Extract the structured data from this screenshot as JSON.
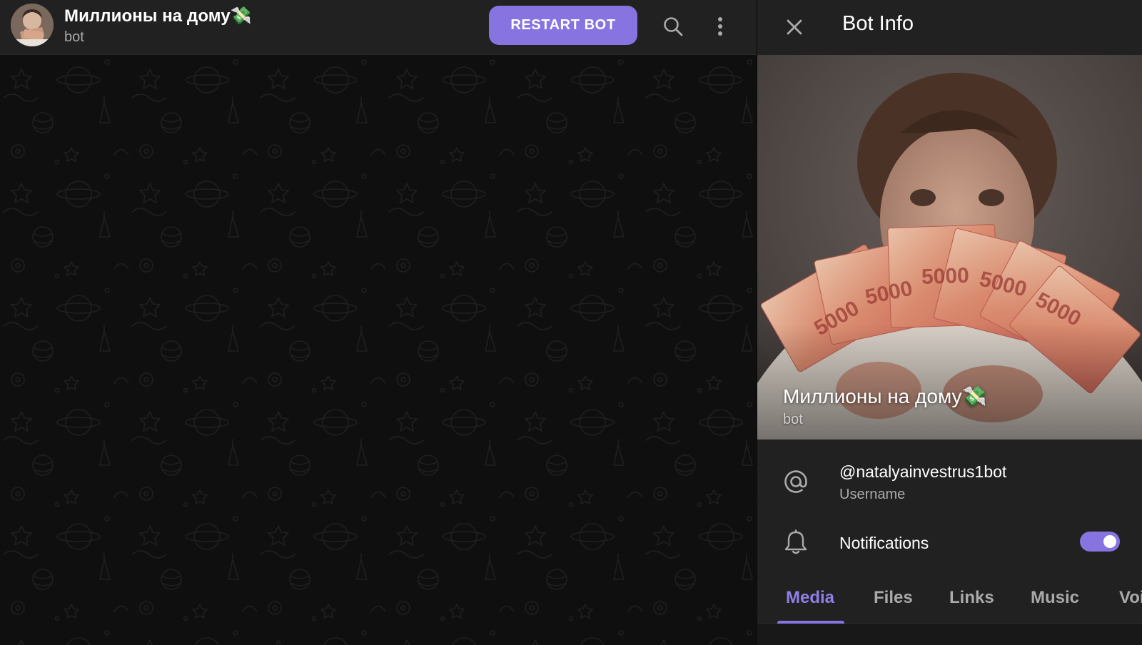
{
  "chat": {
    "title": "Миллионы на дому💸",
    "subtitle": "bot",
    "restart_label": "RESTART BOT",
    "icons": {
      "search": "search-icon",
      "menu": "more-vertical-icon"
    }
  },
  "info_panel": {
    "title": "Bot Info",
    "close_icon": "close-icon",
    "profile": {
      "name": "Миллионы на дому💸",
      "subtitle": "bot"
    },
    "username": {
      "value": "@natalyainvestrus1bot",
      "label": "Username",
      "icon": "at-icon"
    },
    "notifications": {
      "label": "Notifications",
      "enabled": true,
      "icon": "bell-icon"
    },
    "tabs": [
      {
        "label": "Media",
        "active": true
      },
      {
        "label": "Files",
        "active": false
      },
      {
        "label": "Links",
        "active": false
      },
      {
        "label": "Music",
        "active": false
      },
      {
        "label": "Voi",
        "active": false
      }
    ]
  },
  "colors": {
    "accent": "#8774e1",
    "header_bg": "#212121",
    "chat_bg": "#0f0f0f",
    "muted_text": "#aaaaaa"
  }
}
